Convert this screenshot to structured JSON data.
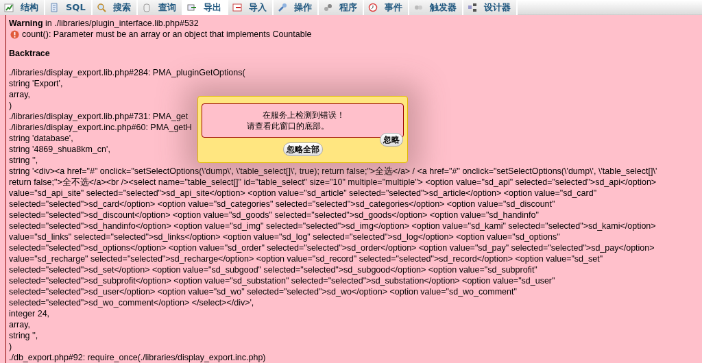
{
  "tabs": [
    {
      "label": "结构",
      "selected": false
    },
    {
      "label": "SQL",
      "selected": false
    },
    {
      "label": "搜索",
      "selected": false
    },
    {
      "label": "查询",
      "selected": false
    },
    {
      "label": "导出",
      "selected": true
    },
    {
      "label": "导入",
      "selected": false
    },
    {
      "label": "操作",
      "selected": false
    },
    {
      "label": "程序",
      "selected": false
    },
    {
      "label": "事件",
      "selected": false
    },
    {
      "label": "触发器",
      "selected": false
    },
    {
      "label": "设计器",
      "selected": false
    }
  ],
  "warning": {
    "label": "Warning",
    "text": "in ./libraries/plugin_interface.lib.php#532"
  },
  "error_message": "count(): Parameter must be an array or an object that implements Countable",
  "backtrace_title": "Backtrace",
  "backtrace_lines": [
    "./libraries/display_export.lib.php#284: PMA_pluginGetOptions(",
    "string 'Export',",
    "array,",
    ")",
    "./libraries/display_export.lib.php#731: PMA_get",
    "./libraries/display_export.inc.php#60: PMA_getH",
    "string 'database',",
    "string '4869_shua8km_cn',",
    "string '',",
    "string '<div><a href=\"#\" onclick=\"setSelectOptions(\\'dump\\', \\'table_select[]\\', true); return false;\">全选</a> / <a href=\"#\" onclick=\"setSelectOptions(\\'dump\\', \\'table_select[]\\'",
    "return false;\">全不选</a><br /><select name=\"table_select[]\" id=\"table_select\" size=\"10\" multiple=\"multiple\"> <option value=\"sd_api\" selected=\"selected\">sd_api</option>",
    "value=\"sd_api_site\" selected=\"selected\">sd_api_site</option> <option value=\"sd_article\" selected=\"selected\">sd_article</option> <option value=\"sd_card\"",
    "selected=\"selected\">sd_card</option> <option value=\"sd_categories\" selected=\"selected\">sd_categories</option> <option value=\"sd_discount\"",
    "selected=\"selected\">sd_discount</option> <option value=\"sd_goods\" selected=\"selected\">sd_goods</option> <option value=\"sd_handinfo\"",
    "selected=\"selected\">sd_handinfo</option> <option value=\"sd_img\" selected=\"selected\">sd_img</option> <option value=\"sd_kami\" selected=\"selected\">sd_kami</option>",
    "value=\"sd_links\" selected=\"selected\">sd_links</option> <option value=\"sd_log\" selected=\"selected\">sd_log</option> <option value=\"sd_options\"",
    "selected=\"selected\">sd_options</option> <option value=\"sd_order\" selected=\"selected\">sd_order</option> <option value=\"sd_pay\" selected=\"selected\">sd_pay</option>",
    "value=\"sd_recharge\" selected=\"selected\">sd_recharge</option> <option value=\"sd_record\" selected=\"selected\">sd_record</option> <option value=\"sd_set\"",
    "selected=\"selected\">sd_set</option> <option value=\"sd_subgood\" selected=\"selected\">sd_subgood</option> <option value=\"sd_subprofit\"",
    "selected=\"selected\">sd_subprofit</option> <option value=\"sd_substation\" selected=\"selected\">sd_substation</option> <option value=\"sd_user\"",
    "selected=\"selected\">sd_user</option> <option value=\"sd_wo\" selected=\"selected\">sd_wo</option> <option value=\"sd_wo_comment\"",
    "selected=\"selected\">sd_wo_comment</option> </select></div>',",
    "integer 24,",
    "array,",
    "string '',",
    ")",
    "./db_export.php#92: require_once(./libraries/display_export.inc.php)"
  ],
  "dialog": {
    "message_lines": [
      "在服务上检测到错误！",
      "请查看此窗口的底部。"
    ],
    "ignore_button": "忽略",
    "ignore_all_button": "忽略全部"
  }
}
